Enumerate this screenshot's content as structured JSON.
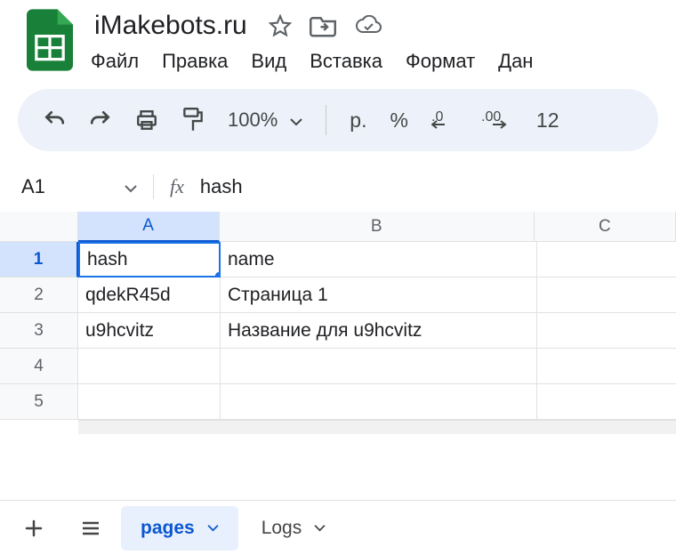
{
  "header": {
    "title": "iMakebots.ru",
    "menu": [
      "Файл",
      "Правка",
      "Вид",
      "Вставка",
      "Формат",
      "Дан"
    ]
  },
  "toolbar": {
    "zoom": "100%",
    "currency": "р.",
    "percent": "%",
    "right_num": "12"
  },
  "namebox": {
    "cell_ref": "A1",
    "fx": "fx",
    "formula_value": "hash"
  },
  "grid": {
    "columns": [
      "A",
      "B",
      "C"
    ],
    "rows": [
      "1",
      "2",
      "3",
      "4",
      "5"
    ],
    "data": [
      [
        "hash",
        "name",
        ""
      ],
      [
        "qdekR45d",
        "Страница 1",
        ""
      ],
      [
        "u9hcvitz",
        "Название для u9hcvitz",
        ""
      ],
      [
        "",
        "",
        ""
      ],
      [
        "",
        "",
        ""
      ]
    ],
    "selected": {
      "row": 0,
      "col": 0
    }
  },
  "tabs": {
    "sheets": [
      {
        "name": "pages",
        "active": true
      },
      {
        "name": "Logs",
        "active": false
      }
    ]
  }
}
